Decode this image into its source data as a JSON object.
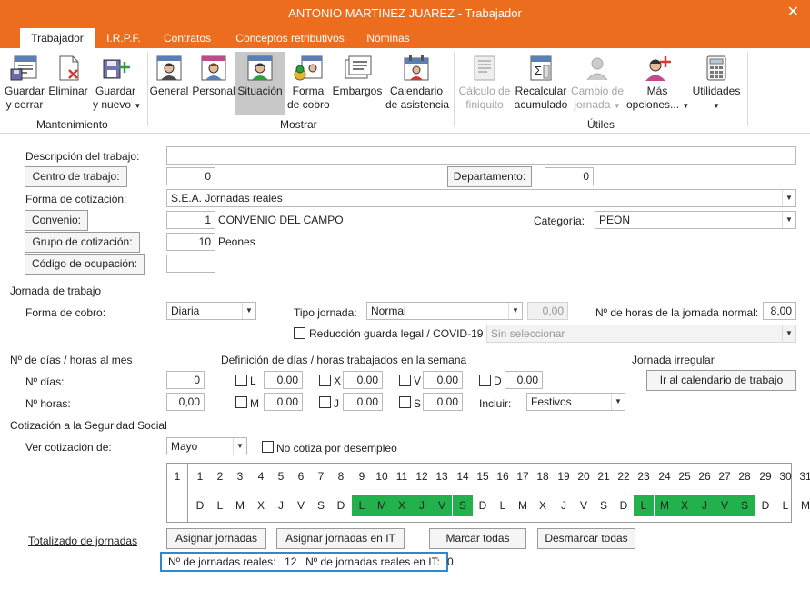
{
  "window": {
    "title": "ANTONIO MARTINEZ JUAREZ - Trabajador",
    "close_glyph": "✕"
  },
  "tabs": [
    "Trabajador",
    "I.R.P.F.",
    "Contratos",
    "Conceptos retributivos",
    "Nóminas"
  ],
  "ribbon": {
    "groups": {
      "mantenimiento": "Mantenimiento",
      "mostrar": "Mostrar",
      "utiles": "Útiles"
    },
    "buttons": {
      "guardar_cerrar": [
        "Guardar",
        "y cerrar"
      ],
      "eliminar": [
        "Eliminar",
        ""
      ],
      "guardar_nuevo": [
        "Guardar",
        "y nuevo"
      ],
      "general": [
        "General",
        ""
      ],
      "personal": [
        "Personal",
        ""
      ],
      "situacion": [
        "Situación",
        ""
      ],
      "forma_cobro": [
        "Forma",
        "de cobro"
      ],
      "embargos": [
        "Embargos",
        ""
      ],
      "calendario": [
        "Calendario",
        "de asistencia"
      ],
      "calculo_finiquito": [
        "Cálculo de",
        "finiquito"
      ],
      "recalcular": [
        "Recalcular",
        "acumulado"
      ],
      "cambio_jornada": [
        "Cambio de",
        "jornada"
      ],
      "mas_opciones": [
        "Más",
        "opciones..."
      ],
      "utilidades": [
        "Utilidades",
        ""
      ]
    },
    "icons": {
      "guardar_cerrar": "save-close-icon",
      "eliminar": "delete-icon",
      "guardar_nuevo": "save-new-icon",
      "general": "worker-general-icon",
      "personal": "worker-personal-icon",
      "situacion": "worker-situation-icon",
      "forma_cobro": "payment-method-icon",
      "embargos": "garnishment-icon",
      "calendario": "calendar-icon",
      "calculo_finiquito": "settlement-calc-icon",
      "recalcular": "recalculate-icon",
      "cambio_jornada": "change-shift-icon",
      "mas_opciones": "more-options-icon",
      "utilidades": "utilities-calculator-icon"
    }
  },
  "form": {
    "descripcion_label": "Descripción del trabajo:",
    "descripcion_value": "",
    "centro_label": "Centro de trabajo:",
    "centro_value": "0",
    "departamento_label": "Departamento:",
    "departamento_value": "0",
    "forma_cotizacion_label": "Forma de cotización:",
    "forma_cotizacion_value": "S.E.A. Jornadas reales",
    "convenio_label": "Convenio:",
    "convenio_code": "1",
    "convenio_name": "CONVENIO DEL CAMPO",
    "categoria_label": "Categoría:",
    "categoria_value": "PEON",
    "grupo_label": "Grupo de cotización:",
    "grupo_code": "10",
    "grupo_name": "Peones",
    "codigo_ocupacion_label": "Código de ocupación:",
    "codigo_ocupacion_value": ""
  },
  "jornada": {
    "section": "Jornada de trabajo",
    "forma_cobro_label": "Forma de cobro:",
    "forma_cobro_value": "Diaria",
    "tipo_label": "Tipo jornada:",
    "tipo_value": "Normal",
    "tipo_num": "0,00",
    "horas_label": "Nº de horas de la jornada normal:",
    "horas_value": "8,00",
    "reduccion_label": "Reducción guarda legal / COVID-19",
    "reduccion_value": "Sin seleccionar"
  },
  "dias_horas": {
    "section_mes": "Nº de días / horas al mes",
    "section_semana": "Definición de días / horas trabajados en la semana",
    "section_irregular": "Jornada irregular",
    "n_dias_label": "Nº días:",
    "n_dias_value": "0",
    "n_horas_label": "Nº horas:",
    "n_horas_value": "0,00",
    "week": [
      {
        "day": "L",
        "value": "0,00"
      },
      {
        "day": "X",
        "value": "0,00"
      },
      {
        "day": "V",
        "value": "0,00"
      },
      {
        "day": "D",
        "value": "0,00"
      },
      {
        "day": "M",
        "value": "0,00"
      },
      {
        "day": "J",
        "value": "0,00"
      },
      {
        "day": "S",
        "value": "0,00"
      }
    ],
    "incluir_label": "Incluir:",
    "incluir_value": "Festivos",
    "ir_calendario_btn": "Ir al calendario de trabajo"
  },
  "cotizacion": {
    "section": "Cotización a la Seguridad Social",
    "ver_label": "Ver cotización de:",
    "mes_value": "Mayo",
    "no_cotiza_label": "No cotiza por desempleo",
    "first_col": "1",
    "days": [
      "1",
      "2",
      "3",
      "4",
      "5",
      "6",
      "7",
      "8",
      "9",
      "10",
      "11",
      "12",
      "13",
      "14",
      "15",
      "16",
      "17",
      "18",
      "19",
      "20",
      "21",
      "22",
      "23",
      "24",
      "25",
      "26",
      "27",
      "28",
      "29",
      "30",
      "31"
    ],
    "weekdays": [
      "D",
      "L",
      "M",
      "X",
      "J",
      "V",
      "S",
      "D",
      "L",
      "M",
      "X",
      "J",
      "V",
      "S",
      "D",
      "L",
      "M",
      "X",
      "J",
      "V",
      "S",
      "D",
      "L",
      "M",
      "X",
      "J",
      "V",
      "S",
      "D",
      "L",
      "M"
    ],
    "worked": [
      false,
      false,
      false,
      false,
      false,
      false,
      false,
      false,
      true,
      true,
      true,
      true,
      true,
      true,
      false,
      false,
      false,
      false,
      false,
      false,
      false,
      false,
      true,
      true,
      true,
      true,
      true,
      true,
      false,
      false,
      false
    ],
    "worked_color": "#22B14C"
  },
  "acciones": {
    "totalizado_link": "Totalizado de jornadas",
    "asignar_btn": "Asignar jornadas",
    "asignar_it_btn": "Asignar jornadas en IT",
    "marcar_btn": "Marcar todas",
    "desmarcar_btn": "Desmarcar todas"
  },
  "totales": {
    "reales_label": "Nº de jornadas reales:",
    "reales_value": "12",
    "it_label": "Nº de jornadas reales en IT:",
    "it_value": "0"
  },
  "colors": {
    "accent": "#ED6D1F",
    "highlight_border": "#2E88D0"
  }
}
